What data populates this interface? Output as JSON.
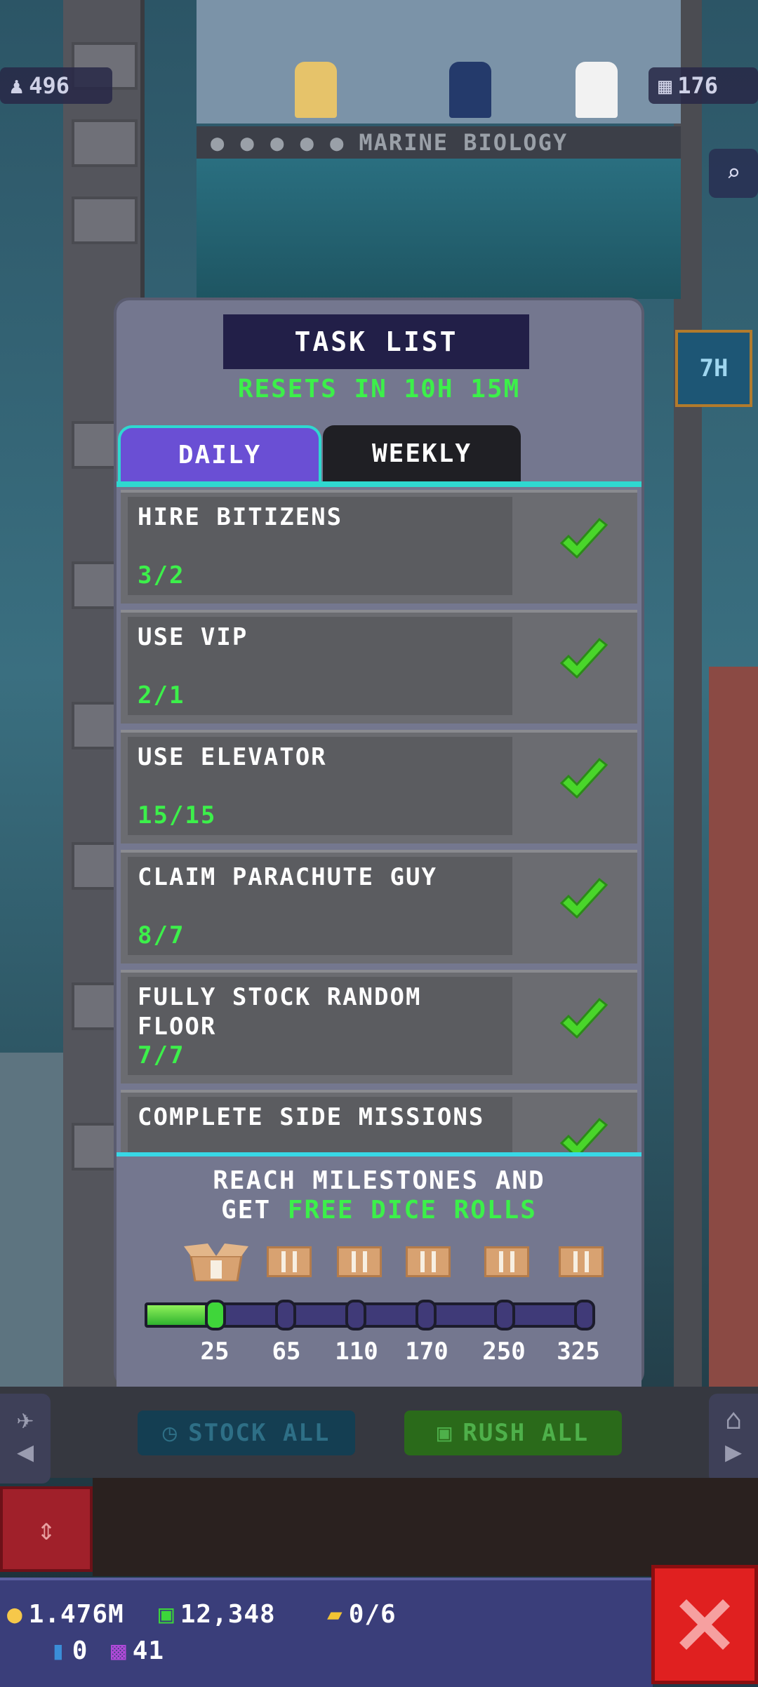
{
  "hud": {
    "population": "496",
    "floors": "176",
    "timer_badge": "7H"
  },
  "floor": {
    "name": "MARINE BIOLOGY"
  },
  "task_list": {
    "title": "TASK LIST",
    "reset_text": "RESETS IN 10H 15M",
    "tabs": [
      {
        "label": "DAILY",
        "active": true
      },
      {
        "label": "WEEKLY",
        "active": false
      }
    ],
    "tasks": [
      {
        "name": "HIRE BITIZENS",
        "progress": "3/2",
        "complete": true
      },
      {
        "name": "USE VIP",
        "progress": "2/1",
        "complete": true
      },
      {
        "name": "USE ELEVATOR",
        "progress": "15/15",
        "complete": true
      },
      {
        "name": "CLAIM PARACHUTE GUY",
        "progress": "8/7",
        "complete": true
      },
      {
        "name": "FULLY STOCK RANDOM FLOOR",
        "progress": "7/7",
        "complete": true
      },
      {
        "name": "COMPLETE SIDE MISSIONS",
        "progress": "",
        "complete": true
      }
    ],
    "milestone_text_line1": "REACH MILESTONES AND",
    "milestone_text_prefix": "GET ",
    "milestone_text_highlight": "FREE DICE ROLLS",
    "milestones": [
      "25",
      "65",
      "110",
      "170",
      "250",
      "325"
    ],
    "milestone_progress_fraction": 0.13
  },
  "controls": {
    "stock_all": "STOCK ALL",
    "rush_all": "RUSH ALL"
  },
  "currency": {
    "coins": "1.476M",
    "bux": "12,348",
    "tickets": "0/6",
    "keys": "0",
    "dice": "41"
  },
  "colors": {
    "accent_green": "#3cf04a",
    "tab_active": "#6a4fd4",
    "close_red": "#e02020"
  }
}
